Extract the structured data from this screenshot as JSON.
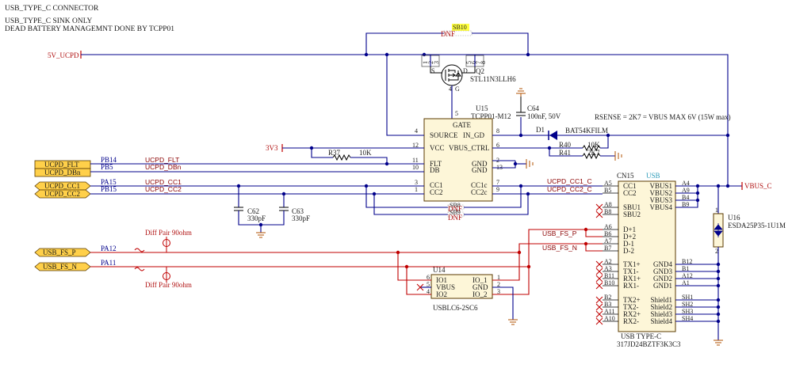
{
  "header": {
    "line1": "USB_TYPE_C CONNECTOR",
    "line2": "USB_TYPE_C SINK ONLY",
    "line3": "DEAD BATTERY MANAGEMNT DONE BY TCPP01"
  },
  "power_nets": {
    "v5": "5V_UCPD",
    "v3": "3V3",
    "vbus": "VBUS_C"
  },
  "ports": {
    "flt": "UCPD_FLT",
    "dbn": "UCPD_DBn",
    "cc1": "UCPD_CC1",
    "cc2": "UCPD_CC2",
    "fsp": "USB_FS_P",
    "fsn": "USB_FS_N"
  },
  "pins_mcu": {
    "pb14": "PB14",
    "pb5": "PB5",
    "pa15": "PA15",
    "pb15": "PB15",
    "pa12": "PA12",
    "pa11": "PA11"
  },
  "net_labels": {
    "flt": "UCPD_FLT",
    "dbn": "UCPD_DBn",
    "cc1": "UCPD_CC1",
    "cc2": "UCPD_CC2",
    "cc1c": "UCPD_CC1_C",
    "cc2c": "UCPD_CC2_C",
    "fsp": "USB_FS_P",
    "fsn": "USB_FS_N"
  },
  "diff_pair": {
    "top": "Diff Pair 90ohm",
    "bottom": "Diff Pair 90ohm"
  },
  "sb10": {
    "label": "SB10",
    "dnf": "DNF"
  },
  "q2": {
    "ref": "Q2",
    "part": "STL11N3LLH6",
    "pins": [
      "1",
      "2",
      "3",
      "5",
      "6",
      "7",
      "8",
      "4"
    ],
    "s": "S",
    "d": "D",
    "g": "G",
    "gnum": "4"
  },
  "u15": {
    "ref": "U15",
    "part": "TCPP01-M12",
    "gate": "GATE",
    "gate_num": "5",
    "left": [
      {
        "num": "4",
        "name": "SOURCE"
      },
      {
        "num": "12",
        "name": "VCC"
      },
      {
        "num": "11",
        "name": "FLT"
      },
      {
        "num": "10",
        "name": "DB"
      },
      {
        "num": "3",
        "name": "CC1"
      },
      {
        "num": "1",
        "name": "CC2"
      }
    ],
    "right": [
      {
        "num": "8",
        "name": "IN_GD"
      },
      {
        "num": "6",
        "name": "VBUS_CTRL"
      },
      {
        "num": "2",
        "name": "GND"
      },
      {
        "num": "13",
        "name": "GND"
      },
      {
        "num": "7",
        "name": "CC1c"
      },
      {
        "num": "9",
        "name": "CC2c"
      }
    ]
  },
  "c64": {
    "ref": "C64",
    "value": "100nF, 50V"
  },
  "d1": {
    "ref": "D1",
    "part": "BAT54KFILM"
  },
  "rsense_note": "RSENSE = 2K7 = VBUS MAX 6V (15W max)",
  "r37": {
    "ref": "R37",
    "value": "10K"
  },
  "r40": {
    "ref": "R40",
    "value": "10K"
  },
  "r41": {
    "ref": "R41",
    "value": "2K7"
  },
  "c62": {
    "ref": "C62",
    "value": "330pF"
  },
  "c63": {
    "ref": "C63",
    "value": "330pF"
  },
  "dnf_boxes": [
    {
      "label": "SB8",
      "dnf": "DNF"
    },
    {
      "label": "SB9",
      "dnf": "DNF"
    }
  ],
  "cn15": {
    "ref": "CN15",
    "title": "USB",
    "type": "USB TYPE-C",
    "part": "317JD24BZTF3K3C3",
    "left": [
      {
        "num": "A5",
        "name": "CC1"
      },
      {
        "num": "B5",
        "name": "CC2"
      },
      {
        "num": "A8",
        "name": "SBU1"
      },
      {
        "num": "B8",
        "name": "SBU2"
      },
      {
        "num": "A6",
        "name": "D+1"
      },
      {
        "num": "B6",
        "name": "D+2"
      },
      {
        "num": "A7",
        "name": "D-1"
      },
      {
        "num": "B7",
        "name": "D-2"
      },
      {
        "num": "A2",
        "name": "TX1+"
      },
      {
        "num": "A3",
        "name": "TX1-"
      },
      {
        "num": "B11",
        "name": "RX1+"
      },
      {
        "num": "B10",
        "name": "RX1-"
      },
      {
        "num": "B2",
        "name": "TX2+"
      },
      {
        "num": "B3",
        "name": "TX2-"
      },
      {
        "num": "A11",
        "name": "RX2+"
      },
      {
        "num": "A10",
        "name": "RX2-"
      }
    ],
    "right": [
      {
        "num": "A4",
        "name": "VBUS1"
      },
      {
        "num": "A9",
        "name": "VBUS2"
      },
      {
        "num": "B4",
        "name": "VBUS3"
      },
      {
        "num": "B9",
        "name": "VBUS4"
      },
      {
        "num": "B12",
        "name": "GND4"
      },
      {
        "num": "B1",
        "name": "GND3"
      },
      {
        "num": "A12",
        "name": "GND2"
      },
      {
        "num": "A1",
        "name": "GND1"
      },
      {
        "num": "SH1",
        "name": "Shield1"
      },
      {
        "num": "SH2",
        "name": "Shield2"
      },
      {
        "num": "SH3",
        "name": "Shield3"
      },
      {
        "num": "SH4",
        "name": "Shield4"
      }
    ]
  },
  "u14": {
    "ref": "U14",
    "part": "USBLC6-2SC6",
    "left": [
      {
        "num": "6",
        "name": "IO1"
      },
      {
        "num": "5",
        "name": "VBUS"
      },
      {
        "num": "4",
        "name": "IO2"
      }
    ],
    "right": [
      {
        "num": "1",
        "name": "IO_1"
      },
      {
        "num": "2",
        "name": "GND"
      },
      {
        "num": "3",
        "name": "IO_2"
      }
    ]
  },
  "u16": {
    "ref": "U16",
    "part": "ESDA25P35-1U1M",
    "pin1": "1",
    "pin2": "2"
  }
}
